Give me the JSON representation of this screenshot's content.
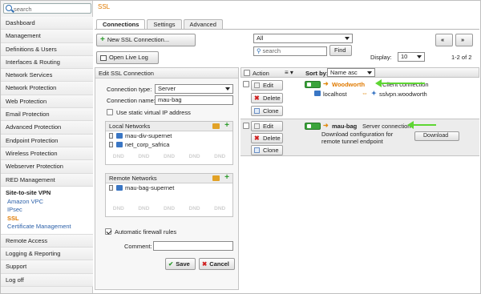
{
  "sidebar": {
    "search_placeholder": "search",
    "items": [
      "Dashboard",
      "Management",
      "Definitions & Users",
      "Interfaces & Routing",
      "Network Services",
      "Network Protection",
      "Web Protection",
      "Email Protection",
      "Advanced Protection",
      "Endpoint Protection",
      "Wireless Protection",
      "Webserver Protection",
      "RED Management"
    ],
    "group": {
      "title": "Site-to-site VPN",
      "subs": [
        "Amazon VPC",
        "IPsec",
        "SSL",
        "Certificate Management"
      ],
      "active": "SSL"
    },
    "items_after": [
      "Remote Access",
      "Logging & Reporting",
      "Support",
      "Log off"
    ]
  },
  "page_title": "SSL",
  "tabs": [
    "Connections",
    "Settings",
    "Advanced"
  ],
  "toolbar": {
    "new_connection": "New SSL Connection...",
    "open_live_log": "Open Live Log",
    "filter_select": "All",
    "search_placeholder": "search",
    "find": "Find",
    "display_label": "Display:",
    "display_value": "10",
    "prev": "«",
    "next": "»",
    "pagination": "1-2 of 2"
  },
  "edit_panel": {
    "title": "Edit SSL Connection",
    "connection_type_label": "Connection type:",
    "connection_type_value": "Server",
    "connection_name_label": "Connection name:",
    "connection_name_value": "mau-bag",
    "static_ip_label": "Use static virtual IP address",
    "local_networks_title": "Local Networks",
    "local_networks": [
      "mau-div-supernet",
      "net_corp_safrica"
    ],
    "remote_networks_title": "Remote Networks",
    "remote_networks": [
      "mau-bag-supernet"
    ],
    "dnd": "DND",
    "auto_firewall_label": "Automatic firewall rules",
    "comment_label": "Comment:",
    "save": "Save",
    "cancel": "Cancel"
  },
  "list": {
    "action_label": "Action",
    "sort_label": "Sort by:",
    "sort_value": "Name asc",
    "rows": [
      {
        "name": "Woodworth",
        "type": "Client connection",
        "local": "localhost",
        "remote": "sslvpn.woodworth",
        "buttons": [
          "Edit",
          "Delete",
          "Clone"
        ]
      },
      {
        "name": "mau-bag",
        "type": "Server connection",
        "desc": "Download configuration for remote tunnel endpoint",
        "download": "Download",
        "buttons": [
          "Edit",
          "Delete",
          "Clone"
        ]
      }
    ]
  },
  "colors": {
    "accent": "#e07a00",
    "link": "#2a5fa8",
    "green": "#3aa43a",
    "arrow": "#5ed633"
  }
}
